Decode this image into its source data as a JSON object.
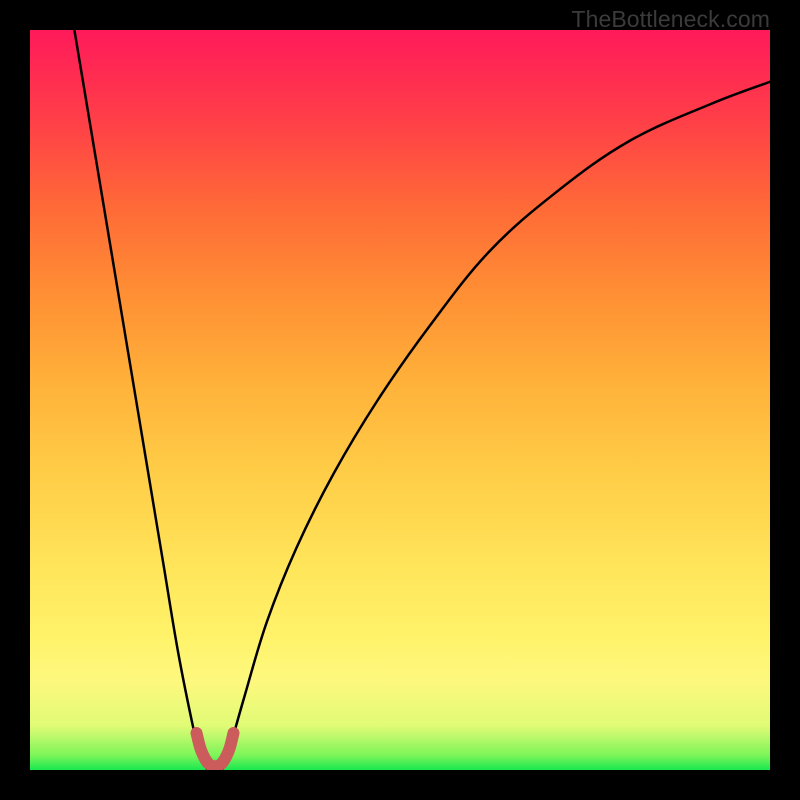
{
  "watermark": "TheBottleneck.com",
  "chart_data": {
    "type": "line",
    "title": "",
    "xlabel": "",
    "ylabel": "",
    "xlim": [
      0,
      100
    ],
    "ylim": [
      0,
      100
    ],
    "background_gradient": {
      "direction": "bottom-to-top",
      "stops": [
        {
          "pct": 0,
          "color": "#18e850"
        },
        {
          "pct": 6,
          "color": "#e1fb76"
        },
        {
          "pct": 18,
          "color": "#fff36a"
        },
        {
          "pct": 40,
          "color": "#ffcd47"
        },
        {
          "pct": 64,
          "color": "#ff9034"
        },
        {
          "pct": 88,
          "color": "#ff3e48"
        },
        {
          "pct": 100,
          "color": "#ff1a5a"
        }
      ]
    },
    "series": [
      {
        "name": "left-branch",
        "stroke": "#000000",
        "stroke_width": 2.5,
        "x": [
          6,
          8,
          10,
          12,
          14,
          16,
          18,
          20,
          22,
          23,
          24
        ],
        "y": [
          100,
          88,
          76,
          64,
          52,
          40,
          28,
          16,
          6,
          2,
          0
        ]
      },
      {
        "name": "right-branch",
        "stroke": "#000000",
        "stroke_width": 2.5,
        "x": [
          26,
          27,
          29,
          32,
          36,
          41,
          47,
          54,
          62,
          71,
          81,
          92,
          100
        ],
        "y": [
          0,
          3,
          10,
          20,
          30,
          40,
          50,
          60,
          70,
          78,
          85,
          90,
          93
        ]
      },
      {
        "name": "trough-highlight",
        "stroke": "#cc5b5b",
        "stroke_width": 12,
        "x": [
          22.5,
          23,
          23.5,
          24,
          24.5,
          25,
          25.5,
          26,
          26.5,
          27,
          27.5
        ],
        "y": [
          5,
          3,
          1.8,
          1,
          0.6,
          0.5,
          0.6,
          1,
          1.8,
          3,
          5
        ]
      }
    ]
  }
}
